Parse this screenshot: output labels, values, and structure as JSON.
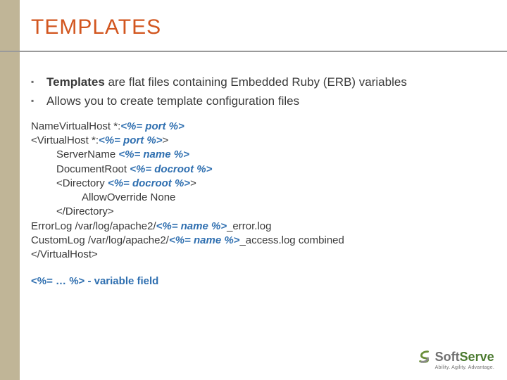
{
  "title": "TEMPLATES",
  "bullets": [
    {
      "strong": "Templates",
      "rest": " are flat files containing Embedded Ruby (ERB) variables"
    },
    {
      "strong": "",
      "rest": "Allows you to create template configuration files"
    }
  ],
  "code": {
    "l1a": "NameVirtualHost *:",
    "l1b": "<%= port %>",
    "l2a": "<VirtualHost *:",
    "l2b": "<%= port %>",
    "l2c": ">",
    "l3a": "ServerName ",
    "l3b": "<%= name %>",
    "l4a": "DocumentRoot ",
    "l4b": "<%= docroot %>",
    "l5a": "<Directory ",
    "l5b": "<%= docroot %>",
    "l5c": ">",
    "l6": "AllowOverride None",
    "l7": "</Directory>",
    "l8a": "ErrorLog /var/log/apache2/",
    "l8b": "<%= name %>",
    "l8c": "_error.log",
    "l9a": "CustomLog /var/log/apache2/",
    "l9b": "<%= name %>",
    "l9c": "_access.log combined",
    "l10": "</VirtualHost>"
  },
  "legend": "<%= … %> - variable field",
  "logo": {
    "name_a": "Soft",
    "name_b": "Serve",
    "tagline": "Ability. Agility. Advantage."
  }
}
